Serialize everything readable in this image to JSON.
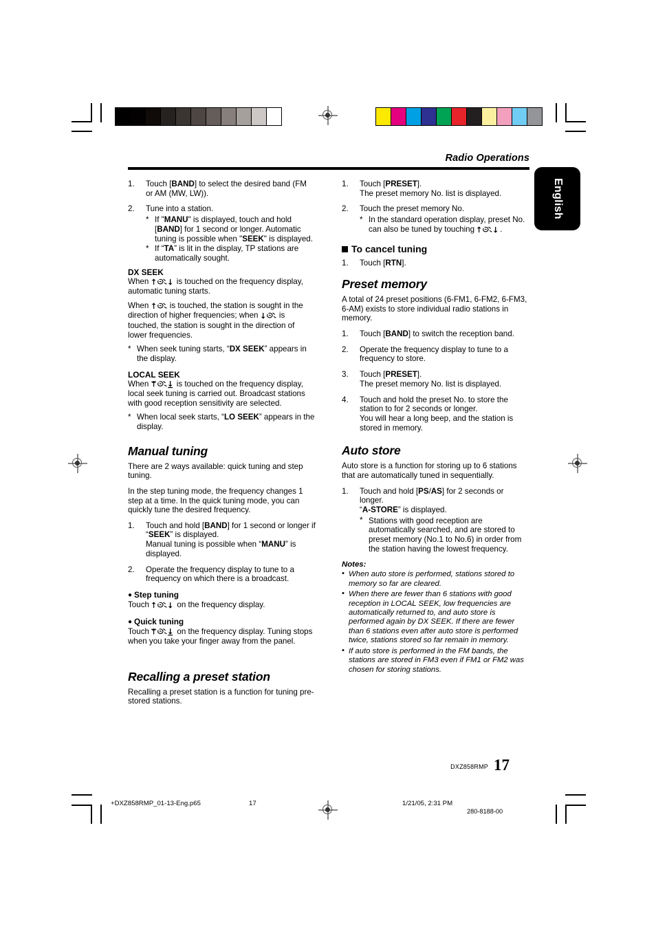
{
  "header": {
    "running_head": "Radio Operations",
    "language_tab": "English"
  },
  "left_column": {
    "auto_tuning_steps": [
      {
        "num": "1.",
        "lines": [
          "Touch [BAND] to select the desired band",
          "(FM or AM (MW, LW))."
        ]
      },
      {
        "num": "2.",
        "lines": [
          "Tune into a station."
        ],
        "stars": [
          "If \"MANU\" is displayed, touch and hold [BAND] for 1 second or longer. Automatic tuning is possible when \"SEEK\" is displayed.",
          "If “TA” is lit in the display, TP stations are automatically sought."
        ]
      }
    ],
    "dx_seek": {
      "title": "DX SEEK",
      "para1": "When ↑✋↓ is touched on the frequency display, automatic tuning starts.",
      "para2": "When ↑✋ is touched, the station is sought in the direction of higher frequencies; when ↓✋ is touched, the station is sought in the direction of lower frequencies.",
      "star": "When seek tuning starts, “DX SEEK” appears in the display."
    },
    "local_seek": {
      "title": "LOCAL SEEK",
      "para1": "When ⇈✋⇊ is touched on the frequency display, local seek tuning is carried out. Broadcast stations with good reception sensitivity are selected.",
      "star": "When local seek starts, “LO SEEK” appears in the display."
    },
    "manual_tuning": {
      "title": "Manual tuning",
      "para1": "There are 2 ways available: quick tuning and step tuning.",
      "para2": "In the step tuning mode, the frequency changes 1 step at a time. In the quick tuning mode, you can quickly tune the desired frequency.",
      "steps": [
        {
          "num": "1.",
          "lines": [
            "Touch and hold [BAND] for 1 second or longer if “SEEK” is displayed. Manual tuning is possible when “MANU” is displayed."
          ]
        },
        {
          "num": "2.",
          "lines": [
            "Operate the frequency display to tune to a frequency on which there is a broadcast."
          ]
        }
      ],
      "step_tuning_head": "Step tuning",
      "step_tuning_body": "Touch ↑✋↓ on the frequency display.",
      "quick_tuning_head": "Quick tuning",
      "quick_tuning_body": "Touch ⇈✋⇊ on the frequency display. Tuning stops when you take your finger away from the panel."
    },
    "recalling": {
      "title": "Recalling a preset station",
      "para1": "Recalling a preset station is a function for tuning pre-stored stations."
    }
  },
  "right_column": {
    "recall_steps": [
      {
        "num": "1.",
        "lines": [
          "Touch [PRESET].",
          "The preset memory No. list is displayed."
        ]
      },
      {
        "num": "2.",
        "lines": [
          "Touch the preset memory No."
        ],
        "stars": [
          "In the standard operation display, preset No. can also be tuned by touching ↑✋↓."
        ]
      }
    ],
    "cancel_tuning": {
      "title": "To cancel tuning",
      "steps": [
        {
          "num": "1.",
          "lines": [
            "Touch [RTN]."
          ]
        }
      ]
    },
    "preset_memory": {
      "title": "Preset memory",
      "para1": "A total of 24 preset positions (6-FM1, 6-FM2, 6-FM3, 6-AM) exists to store individual radio stations in memory.",
      "steps": [
        {
          "num": "1.",
          "lines": [
            "Touch [BAND] to switch the reception band."
          ]
        },
        {
          "num": "2.",
          "lines": [
            "Operate the frequency display to tune to a frequency to store."
          ]
        },
        {
          "num": "3.",
          "lines": [
            "Touch [PRESET].",
            "The preset memory No. list is displayed."
          ]
        },
        {
          "num": "4.",
          "lines": [
            "Touch and hold the preset No. to store the station to for 2 seconds or longer.",
            "You will hear a long beep, and the station is stored in memory."
          ]
        }
      ]
    },
    "auto_store": {
      "title": "Auto store",
      "para1": "Auto store is a function for storing up to 6 stations that are automatically tuned in sequentially.",
      "step": {
        "num": "1.",
        "lines": [
          "Touch and hold [PS/AS] for 2 seconds or longer.",
          "“A-STORE” is displayed."
        ],
        "stars": [
          "Stations with good reception are automatically searched, and are stored to preset memory (No.1 to No.6) in order from the station having the lowest frequency."
        ]
      },
      "notes_title": "Notes:",
      "notes": [
        "When auto store is performed, stations stored to memory so far are cleared.",
        "When there are fewer than 6 stations with good reception in LOCAL SEEK, low frequencies are automatically returned to, and auto store is performed again by DX SEEK. If there are fewer than 6 stations even after auto store is performed twice, stations stored so far remain in memory.",
        "If auto store is performed in the FM bands, the stations are stored in FM3 even if FM1 or FM2 was chosen for storing stations."
      ]
    }
  },
  "footer": {
    "model": "DXZ858RMP",
    "page_number": "17",
    "filename": "+DXZ858RMP_01-13-Eng.p65",
    "foot_page": "17",
    "timestamp": "1/21/05, 2:31 PM",
    "doc_code": "280-8188-00"
  },
  "print_marks": {
    "grayscale_swatches": [
      "#000000",
      "#030101",
      "#100b09",
      "#262220",
      "#3b3532",
      "#4d4643",
      "#655d59",
      "#877f7c",
      "#a6a09c",
      "#cdc8c5",
      "#ffffff"
    ],
    "color_swatches": [
      "#fde800",
      "#e5007e",
      "#00a0e4",
      "#2e3191",
      "#00a254",
      "#e7242a",
      "#231f20",
      "#fbf0a0",
      "#f3a0bf",
      "#72cdf4",
      "#939598"
    ]
  }
}
